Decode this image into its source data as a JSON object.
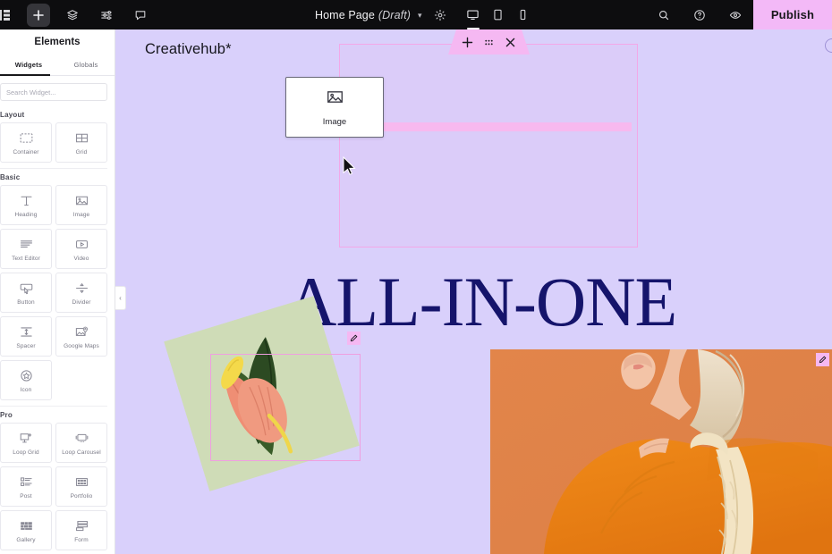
{
  "topbar": {
    "icons": [
      {
        "name": "elementor-logo-icon",
        "glyph": "E"
      },
      {
        "name": "add-element-icon",
        "glyph": "+"
      },
      {
        "name": "layers-icon",
        "glyph": "layers"
      },
      {
        "name": "settings-sliders-icon",
        "glyph": "sliders"
      },
      {
        "name": "comments-icon",
        "glyph": "chat"
      }
    ],
    "page_title": "Home Page",
    "page_state": "(Draft)",
    "dropdown_caret": "▾",
    "gear_icon": "gear-icon",
    "devices": [
      {
        "name": "desktop",
        "label": "Desktop",
        "active": true
      },
      {
        "name": "tablet",
        "label": "Tablet",
        "active": false
      },
      {
        "name": "mobile",
        "label": "Mobile",
        "active": false
      }
    ],
    "right_icons": [
      {
        "name": "search-icon"
      },
      {
        "name": "help-icon"
      },
      {
        "name": "preview-eye-icon"
      }
    ],
    "publish_label": "Publish"
  },
  "panel": {
    "header": "Elements",
    "tabs": [
      {
        "label": "Widgets",
        "active": true
      },
      {
        "label": "Globals",
        "active": false
      }
    ],
    "search_placeholder": "Search Widget...",
    "collapse_icon": "‹",
    "groups": [
      {
        "title": "Layout",
        "widgets": [
          {
            "label": "Container",
            "icon": "container-icon"
          },
          {
            "label": "Grid",
            "icon": "grid-icon"
          }
        ]
      },
      {
        "title": "Basic",
        "widgets": [
          {
            "label": "Heading",
            "icon": "heading-icon"
          },
          {
            "label": "Image",
            "icon": "image-icon"
          },
          {
            "label": "Text Editor",
            "icon": "text-editor-icon"
          },
          {
            "label": "Video",
            "icon": "video-icon"
          },
          {
            "label": "Button",
            "icon": "button-icon"
          },
          {
            "label": "Divider",
            "icon": "divider-icon"
          },
          {
            "label": "Spacer",
            "icon": "spacer-icon"
          },
          {
            "label": "Google Maps",
            "icon": "google-maps-icon"
          },
          {
            "label": "Icon",
            "icon": "star-icon"
          }
        ]
      },
      {
        "title": "Pro",
        "widgets": [
          {
            "label": "Loop Grid",
            "icon": "loop-grid-icon"
          },
          {
            "label": "Loop Carousel",
            "icon": "loop-carousel-icon"
          },
          {
            "label": "Post",
            "icon": "post-icon"
          },
          {
            "label": "Portfolio",
            "icon": "portfolio-icon"
          },
          {
            "label": "Gallery",
            "icon": "gallery-icon"
          },
          {
            "label": "Form",
            "icon": "form-icon"
          }
        ]
      }
    ]
  },
  "canvas": {
    "site_title": "Creativehub*",
    "headline": "ALL-IN-ONE",
    "section_toolbar": [
      {
        "name": "add-section-icon",
        "glyph": "+"
      },
      {
        "name": "drag-handle-icon",
        "glyph": "dots"
      },
      {
        "name": "close-section-icon",
        "glyph": "×"
      }
    ],
    "drag_widget": {
      "label": "Image",
      "icon": "image-icon"
    },
    "drop_indicator": {
      "plus_label": "+"
    },
    "edit_badge_icon": "edit-pencil-icon",
    "images": [
      {
        "name": "flower-image",
        "alt": "Pink anthurium flower on green leaf"
      },
      {
        "name": "model-photo",
        "alt": "Woman in orange knit sweater with mesh bag"
      }
    ]
  },
  "colors": {
    "topbar_bg": "#0d0d0f",
    "publish_bg": "#f3b9f7",
    "canvas_bg": "#d9d0fb",
    "accent_pink": "#f5b8f2",
    "outline_pink": "#f3a8e8",
    "drop_green": "#45b649",
    "headline_navy": "#15146b"
  }
}
